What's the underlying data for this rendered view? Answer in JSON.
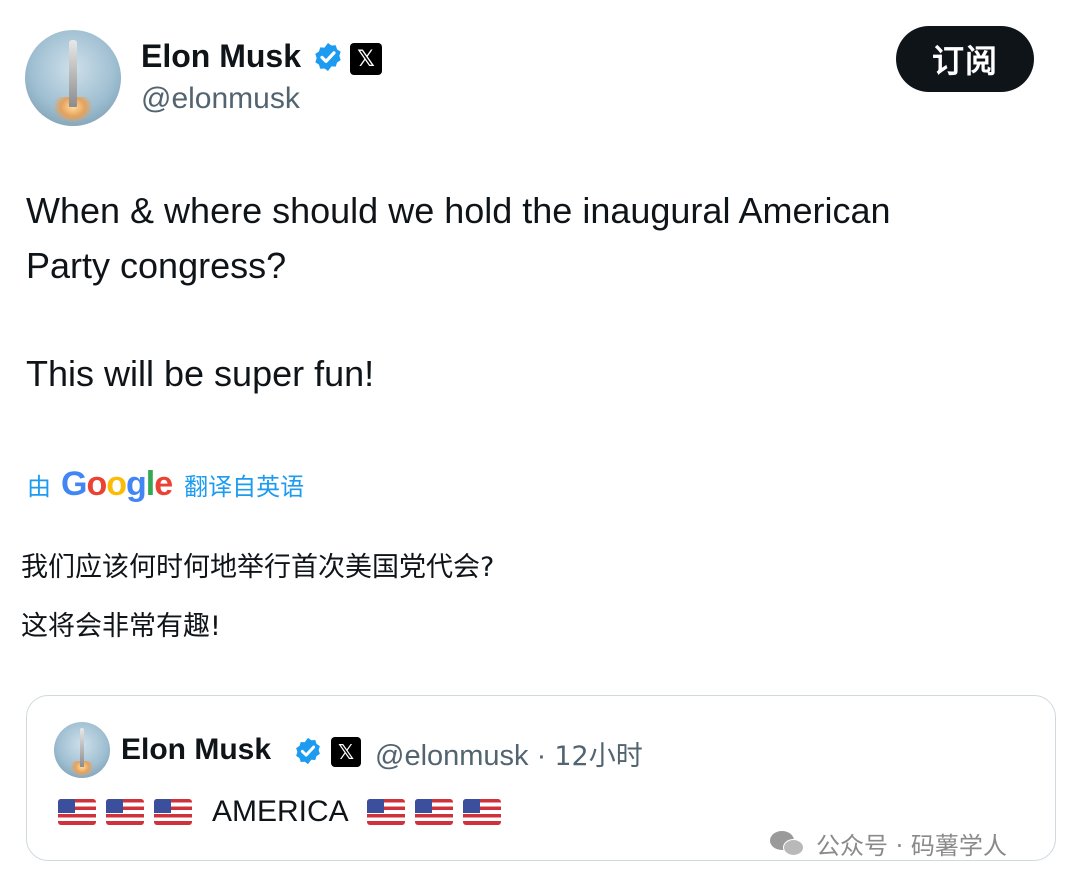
{
  "tweet": {
    "author_name": "Elon Musk",
    "author_handle": "@elonmusk",
    "x_badge": "𝕏",
    "subscribe_label": "订阅",
    "text_lines": [
      "When & where should we hold the inaugural American",
      "Party congress?",
      "This will be super fun!"
    ],
    "translation": {
      "prefix": "由",
      "provider": "Google",
      "suffix": "翻译自英语",
      "lines": [
        "我们应该何时何地举行首次美国党代会?",
        "这将会非常有趣!"
      ]
    }
  },
  "quoted_tweet": {
    "author_name": "Elon Musk",
    "author_handle": "@elonmusk",
    "separator": "·",
    "time": "12小时",
    "x_badge": "𝕏",
    "text": "AMERICA",
    "flags_before": 3,
    "flags_after": 3
  },
  "watermark": {
    "text": "公众号 · 码薯学人"
  },
  "colors": {
    "verified_blue": "#1d9bf0",
    "link_blue": "#1d9bf0",
    "text_primary": "#0f1419",
    "text_secondary": "#536471",
    "card_border": "#cfd9de",
    "google_blue": "#4285f4",
    "google_red": "#ea4335",
    "google_yellow": "#fbbc05",
    "google_green": "#34a853"
  },
  "icons": {
    "verified": "verified-check-icon",
    "x_logo": "x-logo-icon",
    "flag": "us-flag-icon",
    "wechat": "wechat-icon"
  }
}
